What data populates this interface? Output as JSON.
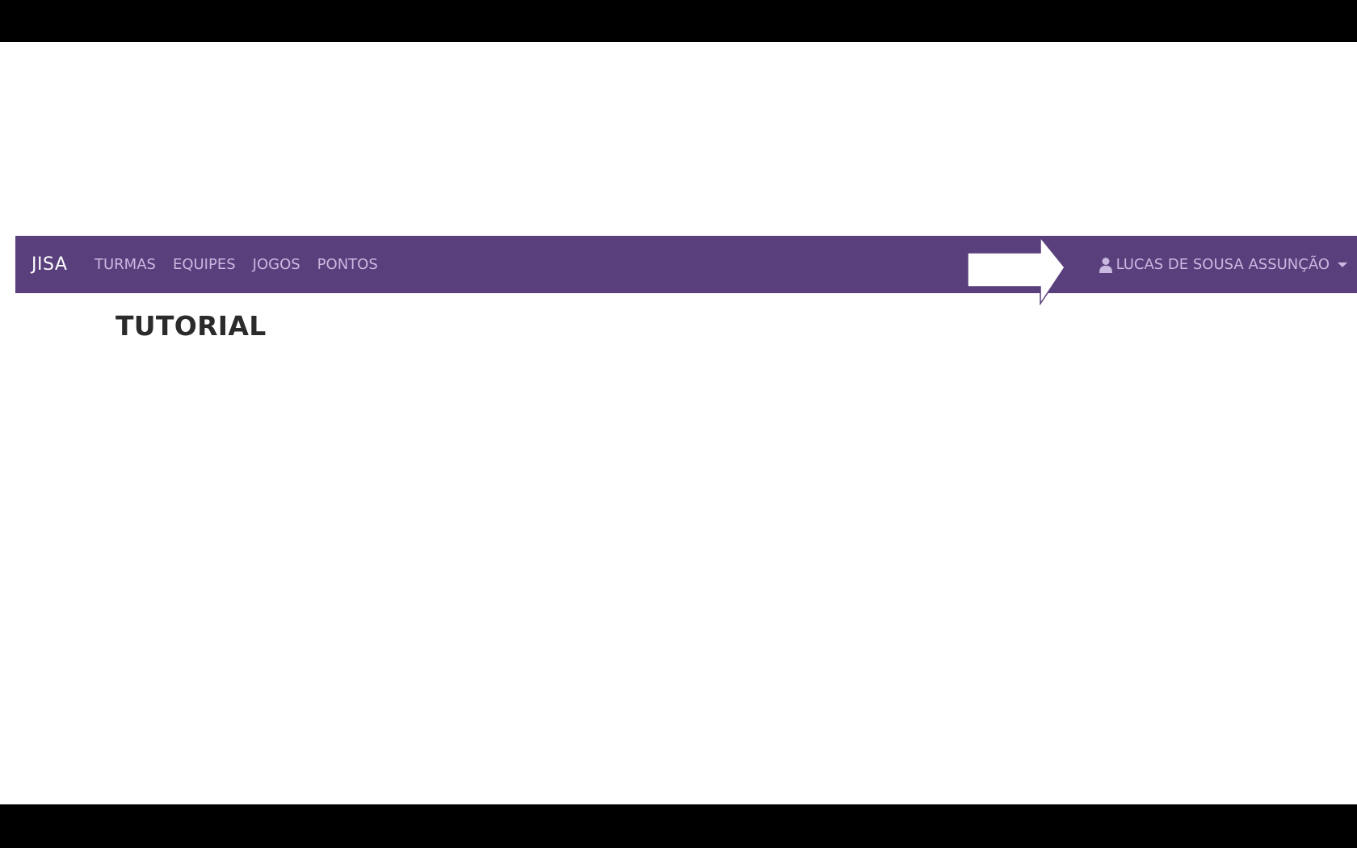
{
  "navbar": {
    "brand": "JISA",
    "links": [
      "TURMAS",
      "EQUIPES",
      "JOGOS",
      "PONTOS"
    ],
    "user_name": "LUCAS DE SOUSA ASSUNÇÃO",
    "user_icon": "user-icon",
    "background_color": "#5a3f7d"
  },
  "main": {
    "title": "TUTORIAL"
  }
}
